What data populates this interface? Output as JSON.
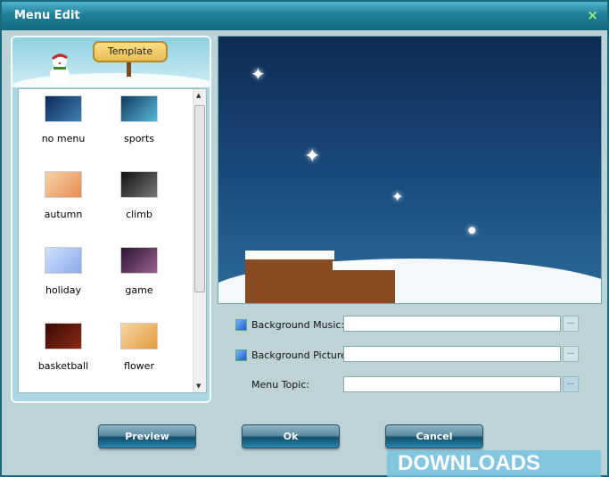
{
  "window": {
    "title": "Menu Edit",
    "close_icon": "×"
  },
  "template_panel": {
    "header": "Template",
    "items": [
      {
        "label": "no menu",
        "colors": [
          "#0c2c5a",
          "#3f7fb0"
        ]
      },
      {
        "label": "sports",
        "colors": [
          "#0f3a5c",
          "#5ab8d8"
        ]
      },
      {
        "label": "autumn",
        "colors": [
          "#f7d3a8",
          "#e88c50"
        ]
      },
      {
        "label": "climb",
        "colors": [
          "#111",
          "#777"
        ]
      },
      {
        "label": "holiday",
        "colors": [
          "#cfe0ff",
          "#8aa9e8"
        ]
      },
      {
        "label": "game",
        "colors": [
          "#2a1530",
          "#9a6090"
        ]
      },
      {
        "label": "basketball",
        "colors": [
          "#3a0a06",
          "#8a2a12"
        ]
      },
      {
        "label": "flower",
        "colors": [
          "#f8d7a0",
          "#e29a40"
        ]
      }
    ]
  },
  "fields": {
    "background_music": {
      "label": "Background Music:",
      "value": "",
      "browse": "..."
    },
    "background_picture": {
      "label": "Background Picture:",
      "value": "",
      "browse": "..."
    },
    "menu_topic": {
      "label": "Menu Topic:",
      "value": "",
      "browse": "..."
    }
  },
  "buttons": {
    "preview": "Preview",
    "ok": "Ok",
    "cancel": "Cancel"
  },
  "watermark": "DOWNLOADS ⇩.GURU"
}
